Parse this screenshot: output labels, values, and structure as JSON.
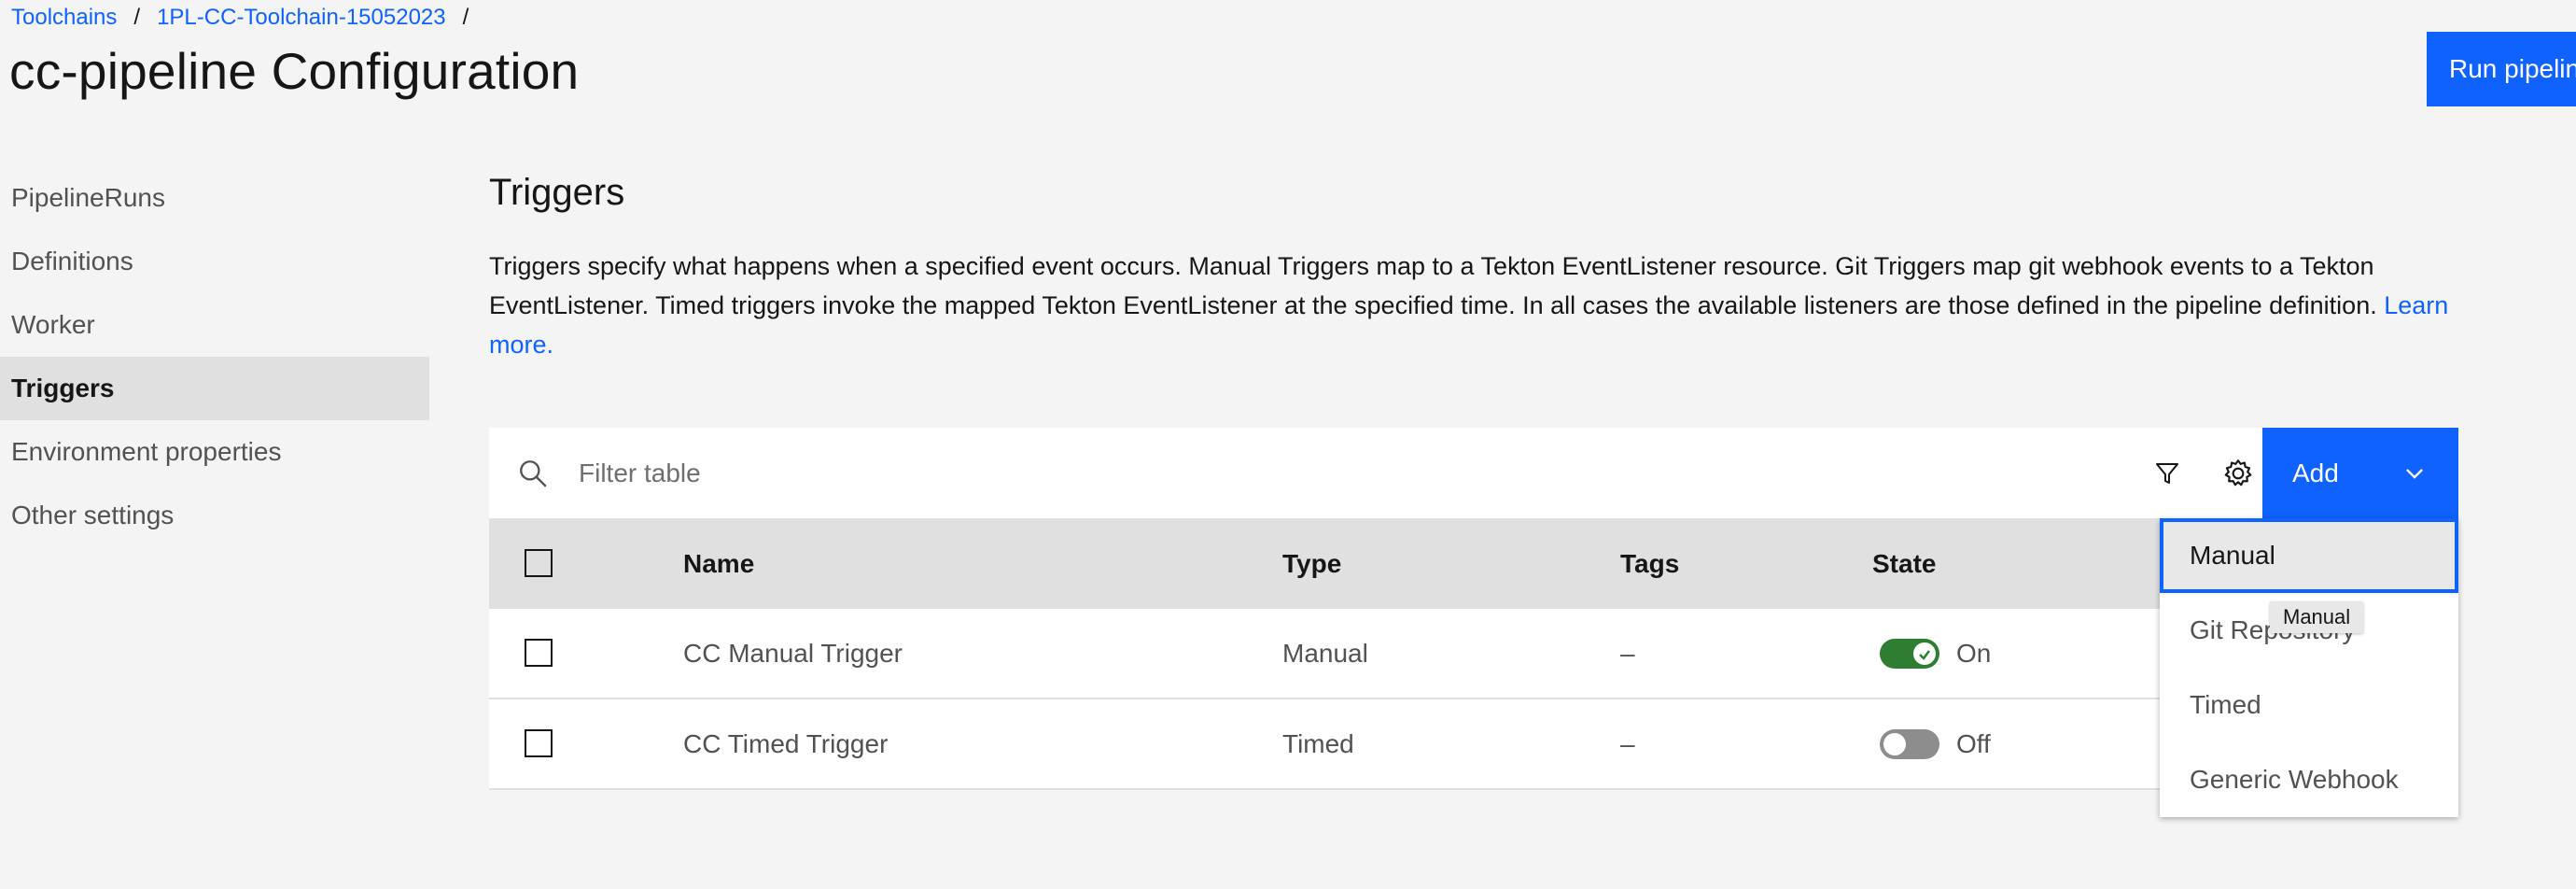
{
  "breadcrumb": {
    "items": [
      "Toolchains",
      "1PL-CC-Toolchain-15052023"
    ],
    "separator": "/"
  },
  "page": {
    "title": "cc-pipeline Configuration"
  },
  "header": {
    "run_button_label": "Run pipeline"
  },
  "sidenav": {
    "items": [
      {
        "label": "PipelineRuns"
      },
      {
        "label": "Definitions"
      },
      {
        "label": "Worker"
      },
      {
        "label": "Triggers",
        "active": true
      },
      {
        "label": "Environment properties"
      },
      {
        "label": "Other settings"
      }
    ]
  },
  "section": {
    "title": "Triggers",
    "description": "Triggers specify what happens when a specified event occurs. Manual Triggers map to a Tekton EventListener resource. Git Triggers map git webhook events to a Tekton EventListener. Timed triggers invoke the mapped Tekton EventListener at the specified time. In all cases the available listeners are those defined in the pipeline definition.",
    "learn_more": "Learn more."
  },
  "toolbar": {
    "search_placeholder": "Filter table",
    "filter_icon": "filter-icon",
    "settings_icon": "gear-icon",
    "add_label": "Add"
  },
  "table": {
    "columns": [
      "Name",
      "Type",
      "Tags",
      "State"
    ],
    "rows": [
      {
        "name": "CC Manual Trigger",
        "type": "Manual",
        "tags": "–",
        "state": "On"
      },
      {
        "name": "CC Timed Trigger",
        "type": "Timed",
        "tags": "–",
        "state": "Off"
      }
    ]
  },
  "add_menu": {
    "items": [
      "Manual",
      "Git Repository",
      "Timed",
      "Generic Webhook"
    ],
    "selected": "Manual",
    "tooltip": "Manual"
  },
  "colors": {
    "primary": "#0f62fe",
    "toggle_on": "#2e7d32",
    "toggle_off": "#8d8d8d",
    "background": "#f4f4f4"
  }
}
